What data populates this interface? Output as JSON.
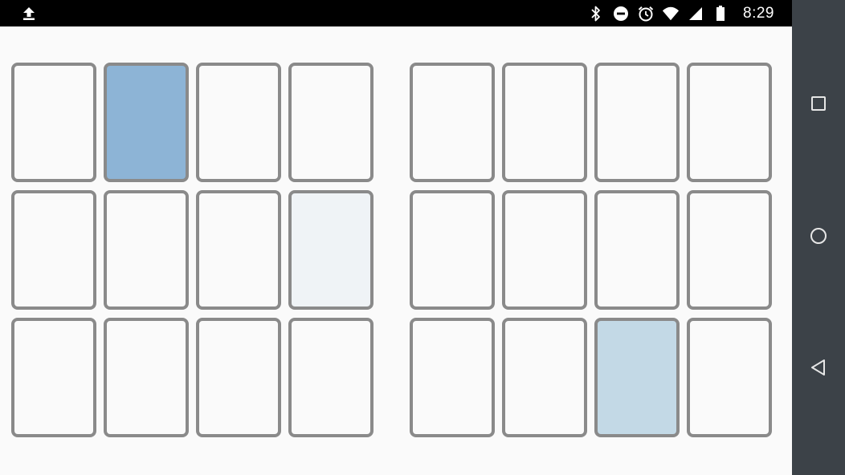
{
  "status_bar": {
    "time": "8:29",
    "icons": [
      "upload-icon",
      "bluetooth-icon",
      "do-not-disturb-icon",
      "alarm-icon",
      "wifi-icon",
      "signal-icon",
      "battery-icon"
    ]
  },
  "board": {
    "left_grid": [
      {
        "state": "empty"
      },
      {
        "state": "selected",
        "color": "#8db4d6"
      },
      {
        "state": "empty"
      },
      {
        "state": "empty"
      },
      {
        "state": "empty"
      },
      {
        "state": "empty"
      },
      {
        "state": "empty"
      },
      {
        "state": "faint",
        "color": "#eff3f6"
      },
      {
        "state": "empty"
      },
      {
        "state": "empty"
      },
      {
        "state": "empty"
      },
      {
        "state": "empty"
      }
    ],
    "right_grid": [
      {
        "state": "empty"
      },
      {
        "state": "empty"
      },
      {
        "state": "empty"
      },
      {
        "state": "empty"
      },
      {
        "state": "empty"
      },
      {
        "state": "empty"
      },
      {
        "state": "empty"
      },
      {
        "state": "empty"
      },
      {
        "state": "empty"
      },
      {
        "state": "empty"
      },
      {
        "state": "highlighted",
        "color": "#c3d9e6"
      },
      {
        "state": "empty"
      }
    ]
  },
  "colors": {
    "card_border": "#8a8a8a",
    "card_empty": "#fafafa",
    "background": "#fafafa",
    "nav_bar": "#3c4248",
    "status_bar": "#000000"
  },
  "nav_bar": {
    "buttons": [
      "recents-square-icon",
      "home-circle-icon",
      "back-triangle-icon"
    ]
  }
}
